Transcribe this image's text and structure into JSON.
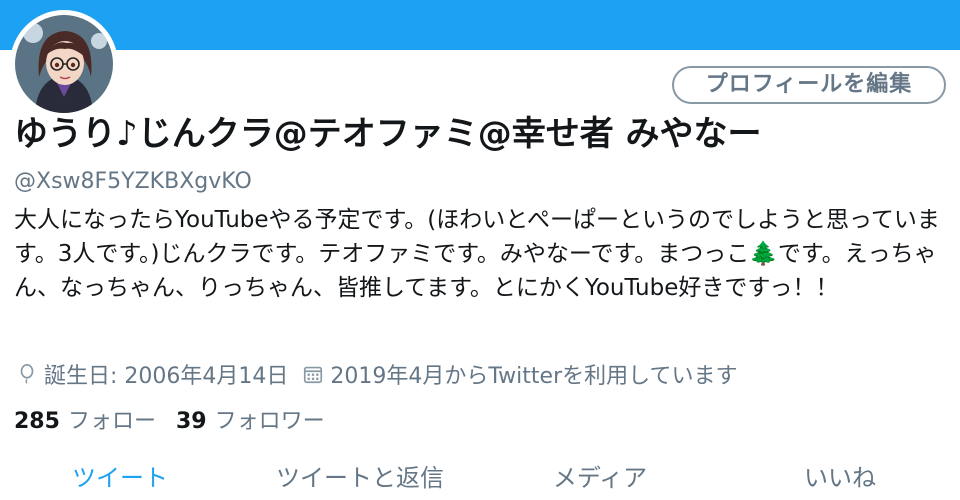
{
  "profile": {
    "display_name": "ゆうり♪じんクラ@テオファミ@幸せ者 みやなー",
    "handle": "@Xsw8F5YZKBXgvKO",
    "edit_button_label": "プロフィールを編集",
    "bio": "大人になったらYouTubeやる予定です。(ほわいとぺーぱーというのでしようと思っています。3人です。)じんクラです。テオファミです。みやなーです。まつっこ🌲です。えっちゃん、なっちゃん、りっちゃん、皆推してます。とにかくYouTube好きですっ！！",
    "birthday": "誕生日: 2006年4月14日",
    "joined": "2019年4月からTwitterを利用しています",
    "following_count": "285",
    "following_label": "フォロー",
    "followers_count": "39",
    "followers_label": "フォロワー"
  },
  "tabs": [
    {
      "label": "ツイート",
      "active": true
    },
    {
      "label": "ツイートと返信",
      "active": false
    },
    {
      "label": "メディア",
      "active": false
    },
    {
      "label": "いいね",
      "active": false
    }
  ],
  "colors": {
    "accent": "#1da1f2",
    "secondary_text": "#657786",
    "primary_text": "#14171a"
  },
  "icons": {
    "birthday": "balloon-icon",
    "joined": "calendar-icon"
  }
}
